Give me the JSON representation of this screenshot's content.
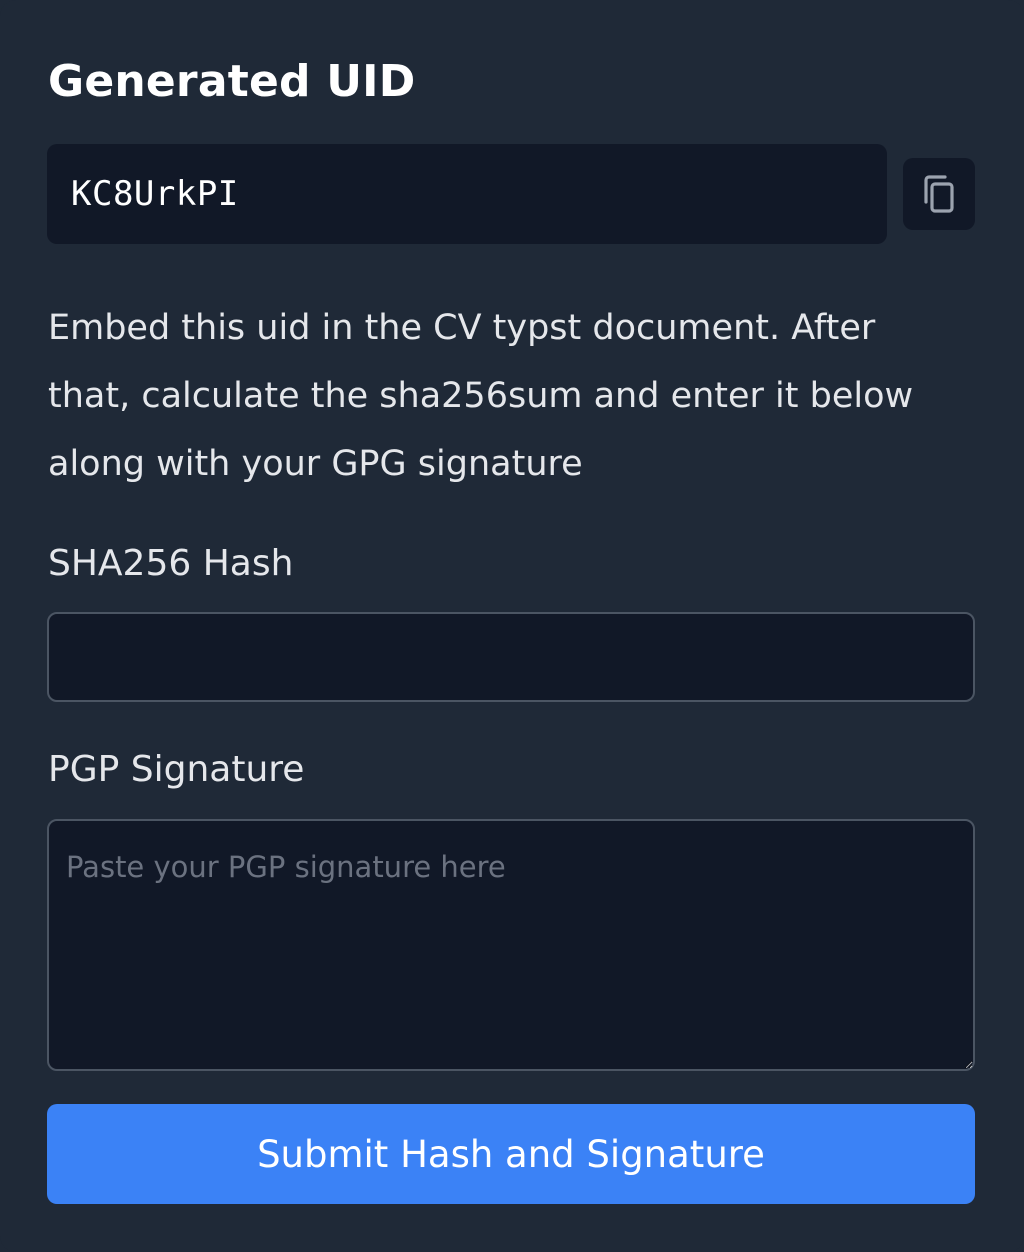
{
  "card": {
    "title": "Generated UID",
    "uid_value": "KC8UrkPI",
    "copy_icon": "copy-icon",
    "description": "Embed this uid in the CV typst document. After that, calculate the sha256sum and enter it below along with your GPG signature"
  },
  "form": {
    "hash_label": "SHA256 Hash",
    "hash_value": "",
    "hash_placeholder": "",
    "signature_label": "PGP Signature",
    "signature_placeholder": "Paste your PGP signature here",
    "submit_label": "Submit Hash and Signature"
  },
  "colors": {
    "background": "#1f2937",
    "field_background": "#111827",
    "border": "#4b5563",
    "accent": "#3b82f6",
    "text": "#e5e7eb",
    "placeholder": "#6b7280"
  }
}
